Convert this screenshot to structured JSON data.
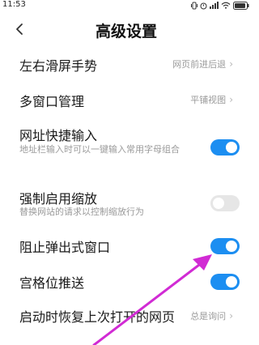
{
  "status": {
    "time": "11:53"
  },
  "header": {
    "title": "高级设置",
    "back_icon": "back-chevron-icon"
  },
  "settings": [
    {
      "title": "左右滑屏手势",
      "value": "网页前进后退",
      "type": "nav"
    },
    {
      "title": "多窗口管理",
      "value": "平铺视图",
      "type": "nav"
    },
    {
      "title": "网址快捷输入",
      "subtitle": "地址栏输入时可以一键输入常用字母组合",
      "type": "toggle",
      "on": true
    },
    {
      "title": "强制启用缩放",
      "subtitle": "替换网站的请求以控制缩放行为",
      "type": "toggle",
      "on": false
    },
    {
      "title": "阻止弹出式窗口",
      "type": "toggle",
      "on": true
    },
    {
      "title": "宫格位推送",
      "type": "toggle",
      "on": true
    },
    {
      "title": "启动时恢复上次打开的网页",
      "value": "总是询问",
      "type": "nav"
    }
  ],
  "colors": {
    "accent": "#1c8ef1",
    "annotation_arrow": "#d12bd4"
  }
}
